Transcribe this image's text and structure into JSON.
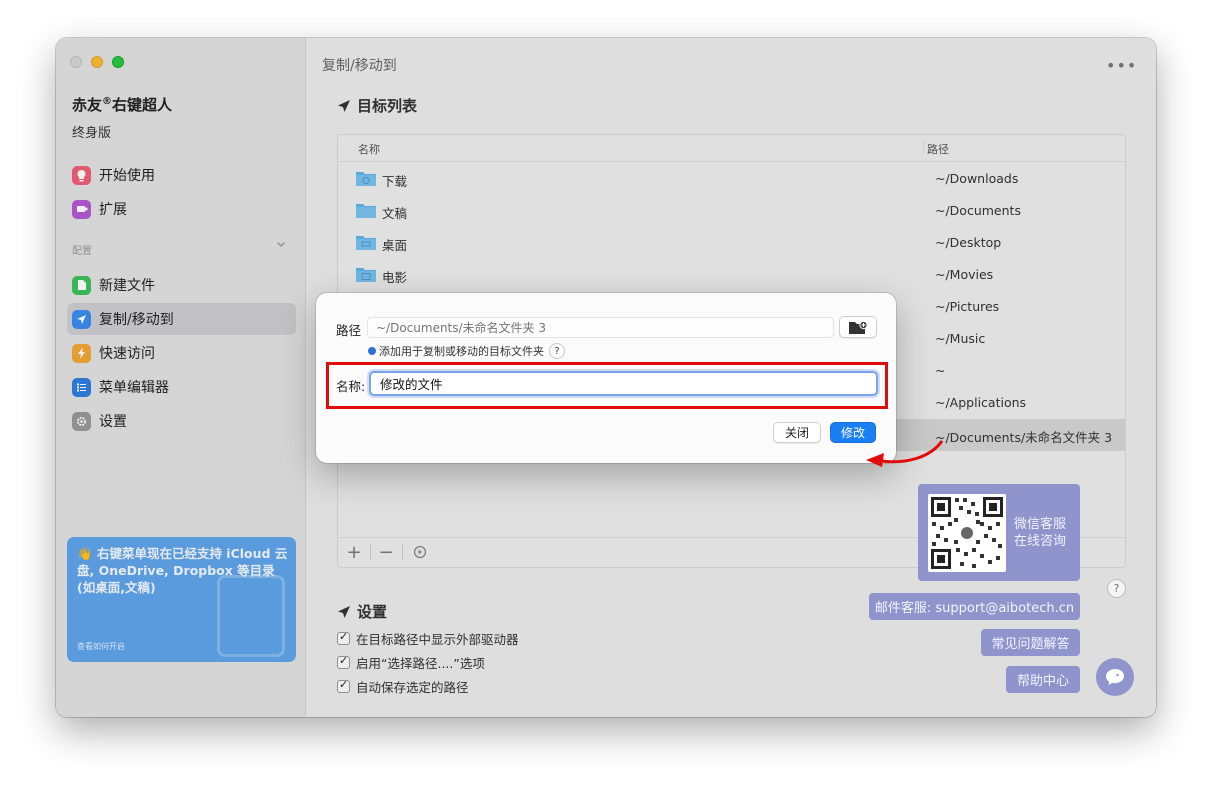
{
  "window": {
    "title": "复制/移动到",
    "more_label": "•••"
  },
  "sidebar": {
    "app_name": "赤友",
    "app_name_mark": "®",
    "app_name_suffix": "右键超人",
    "edition": "终身版",
    "section_label": "配置",
    "items": [
      {
        "label": "开始使用",
        "icon": "lightbulb-icon",
        "color": "#f0607a"
      },
      {
        "label": "扩展",
        "icon": "extension-icon",
        "color": "#b45ad2"
      },
      {
        "label": "新建文件",
        "icon": "new-file-icon",
        "color": "#3cc15b"
      },
      {
        "label": "复制/移动到",
        "icon": "send-icon",
        "color": "#3b8ef0"
      },
      {
        "label": "快速访问",
        "icon": "bolt-icon",
        "color": "#f2a734"
      },
      {
        "label": "菜单编辑器",
        "icon": "list-icon",
        "color": "#2f7fe0"
      },
      {
        "label": "设置",
        "icon": "gear-icon",
        "color": "#9a9a9a"
      }
    ],
    "promo": {
      "emoji": "👋",
      "text": "右键菜单现在已经支持 iCloud 云盘, OneDrive, Dropbox 等目录(如桌面,文稿)",
      "link": "查看如何开启"
    }
  },
  "targets": {
    "heading": "目标列表",
    "columns": {
      "name": "名称",
      "path": "路径"
    },
    "rows": [
      {
        "name": "下载",
        "path": "~/Downloads"
      },
      {
        "name": "文稿",
        "path": "~/Documents"
      },
      {
        "name": "桌面",
        "path": "~/Desktop"
      },
      {
        "name": "电影",
        "path": "~/Movies"
      },
      {
        "name": "",
        "path": "~/Pictures"
      },
      {
        "name": "",
        "path": "~/Music"
      },
      {
        "name": "",
        "path": "~"
      },
      {
        "name": "",
        "path": "~/Applications"
      },
      {
        "name": "",
        "path": "~/Documents/未命名文件夹 3"
      }
    ],
    "toolbar": {
      "add": "+",
      "remove": "−"
    }
  },
  "settings": {
    "heading": "设置",
    "options": [
      {
        "label": "在目标路径中显示外部驱动器",
        "checked": true
      },
      {
        "label": "启用“选择路径....”选项",
        "checked": true
      },
      {
        "label": "自动保存选定的路径",
        "checked": true
      }
    ]
  },
  "help": {
    "qr_line1": "微信客服",
    "qr_line2": "在线咨询",
    "email": "邮件客服: support@aibotech.cn",
    "faq": "常见问题解答",
    "center": "帮助中心",
    "question": "?"
  },
  "dialog": {
    "path_label": "路径",
    "path_placeholder": "~/Documents/未命名文件夹 3",
    "hint": "添加用于复制或移动的目标文件夹",
    "hint_help": "?",
    "name_label": "名称:",
    "name_value": "修改的文件",
    "close_label": "关闭",
    "modify_label": "修改"
  },
  "colors": {
    "accent": "#1a7ef5",
    "highlight": "#e00c0c",
    "help_purple": "#8f94cc"
  }
}
